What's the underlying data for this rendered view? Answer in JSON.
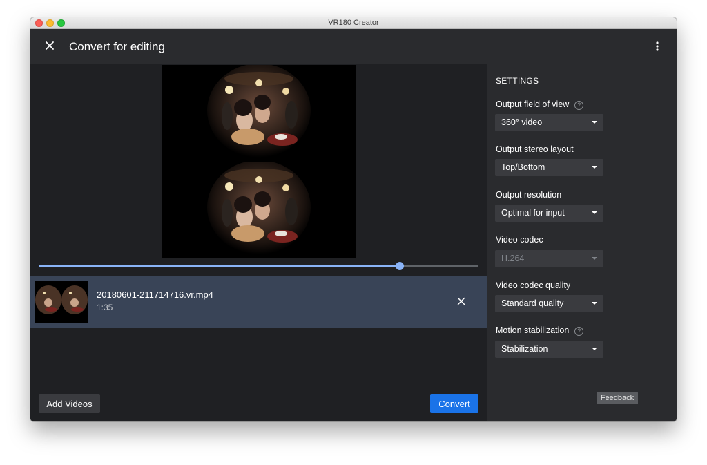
{
  "window": {
    "title": "VR180 Creator"
  },
  "appbar": {
    "title": "Convert for editing"
  },
  "player": {
    "progress": 0.82
  },
  "file": {
    "name": "20180601-211714716.vr.mp4",
    "duration": "1:35"
  },
  "buttons": {
    "add_videos": "Add Videos",
    "convert": "Convert"
  },
  "settings": {
    "heading": "SETTINGS",
    "fields": [
      {
        "label": "Output field of view",
        "value": "360° video",
        "help": "?"
      },
      {
        "label": "Output stereo layout",
        "value": "Top/Bottom"
      },
      {
        "label": "Output resolution",
        "value": "Optimal for input"
      },
      {
        "label": "Video codec",
        "value": "H.264",
        "disabled": true
      },
      {
        "label": "Video codec quality",
        "value": "Standard quality"
      },
      {
        "label": "Motion stabilization",
        "value": "Stabilization",
        "help": "?"
      }
    ]
  },
  "feedback": "Feedback",
  "colors": {
    "accent": "#1a73e8",
    "scrubber": "#8ab4f8",
    "selected_row": "#394457",
    "panel": "#2a2b2e"
  },
  "icons": {
    "close": "close-icon",
    "menu": "more-vert-icon",
    "remove": "close-icon",
    "help": "help-circle-icon",
    "dropdown": "arrow-drop-down-icon"
  }
}
